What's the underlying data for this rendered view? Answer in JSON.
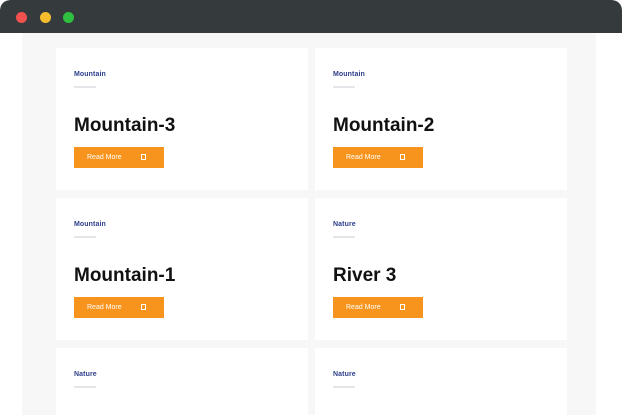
{
  "cards": [
    {
      "category": "Mountain",
      "title": "Mountain-3",
      "button": "Read More"
    },
    {
      "category": "Mountain",
      "title": "Mountain-2",
      "button": "Read More"
    },
    {
      "category": "Mountain",
      "title": "Mountain-1",
      "button": "Read More"
    },
    {
      "category": "Nature",
      "title": "River 3",
      "button": "Read More"
    },
    {
      "category": "Nature",
      "title": "",
      "button": ""
    },
    {
      "category": "Nature",
      "title": "",
      "button": ""
    }
  ],
  "icons": {
    "read_more": "read-more-icon",
    "window_controls": [
      "close-dot",
      "minimize-dot",
      "maximize-dot"
    ]
  },
  "colors": {
    "titlebar": "#353a3d",
    "accent": "#f7941d",
    "category": "#2c3e8a",
    "title": "#111111",
    "page_bg": "#f6f7f6",
    "card_bg": "#ffffff"
  }
}
